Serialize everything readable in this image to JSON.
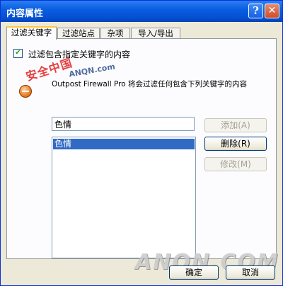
{
  "window": {
    "title": "内容属性",
    "help_label": "?",
    "close_label": "✕"
  },
  "tabs": [
    {
      "label": "过滤关键字",
      "active": true
    },
    {
      "label": "过滤站点",
      "active": false
    },
    {
      "label": "杂项",
      "active": false
    },
    {
      "label": "导入/导出",
      "active": false
    }
  ],
  "filter": {
    "checkbox_label": "过滤包含指定关键字的内容",
    "checked": true,
    "info_text": "Outpost Firewall Pro 将会过滤任何包含下列关键字的内容",
    "keyword_input_value": "色情",
    "keywords": [
      "色情"
    ]
  },
  "side_buttons": {
    "add_label": "添加(A)",
    "delete_label": "删除(R)",
    "modify_label": "修改(M)"
  },
  "dialog_buttons": {
    "ok_label": "确定",
    "cancel_label": "取消"
  },
  "watermarks": {
    "badge_text": "安全中国",
    "site_text": "ANQN.com",
    "logo_text": "ANQN.COM"
  },
  "icons": {
    "help": "help-icon",
    "close": "close-icon",
    "info": "info-icon",
    "check": "check-icon"
  }
}
